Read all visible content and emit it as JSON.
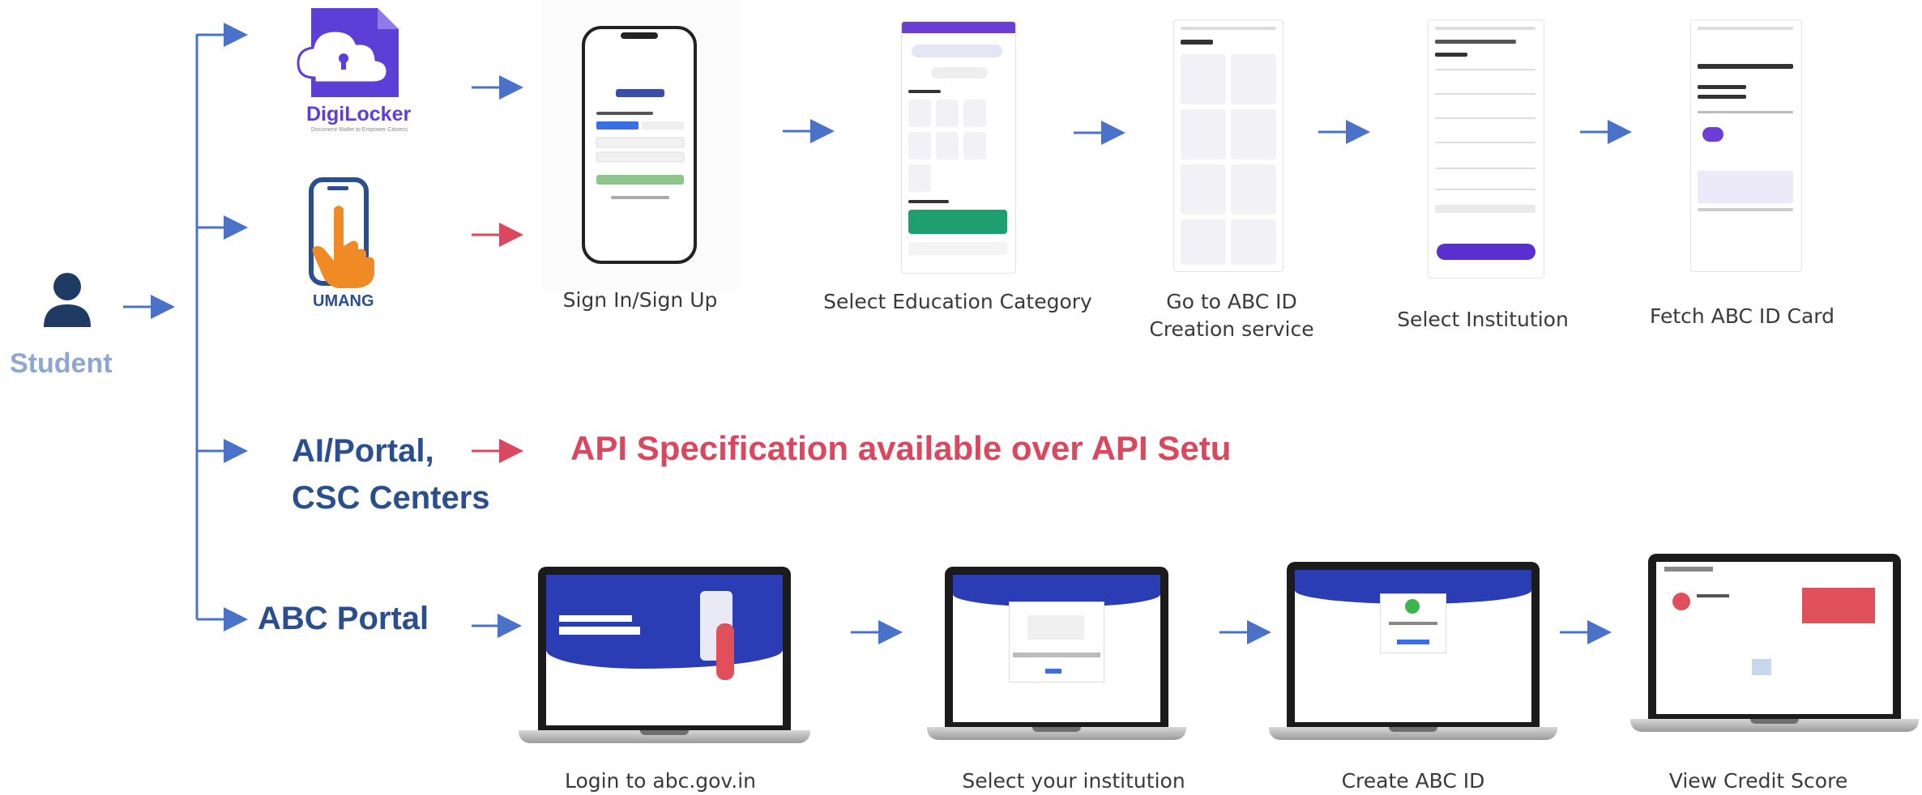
{
  "student": {
    "label": "Student"
  },
  "channels": {
    "digilocker": {
      "logo_text": "DigiLocker",
      "logo_sub": "Document Wallet to Empower Citizens"
    },
    "umang": {
      "logo_text": "UMANG"
    },
    "ai_portal": {
      "line1": "AI/Portal,",
      "line2": "CSC Centers"
    },
    "abc_portal": {
      "label": "ABC Portal"
    }
  },
  "api_note": "API Specification available over API Setu",
  "app_steps": [
    {
      "caption": "Sign In/Sign Up"
    },
    {
      "caption": "Select Education Category"
    },
    {
      "caption": "Go to ABC ID\nCreation service"
    },
    {
      "caption": "Select Institution"
    },
    {
      "caption": "Fetch ABC ID Card"
    }
  ],
  "portal_steps": [
    {
      "caption": "Login to abc.gov.in"
    },
    {
      "caption": "Select your institution"
    },
    {
      "caption": "Create ABC ID"
    },
    {
      "caption": "View Credit Score"
    }
  ],
  "colors": {
    "arrow_blue": "#4a72c8",
    "arrow_red": "#d9485f",
    "label_blue": "#2b4f8e",
    "student_blue": "#8da7d1",
    "digilocker_purple": "#5b3fd6",
    "umang_orange": "#f08a24"
  },
  "icons": {
    "student": "person-icon",
    "digilocker": "digilocker-cloud-icon",
    "umang": "umang-hand-phone-icon"
  }
}
